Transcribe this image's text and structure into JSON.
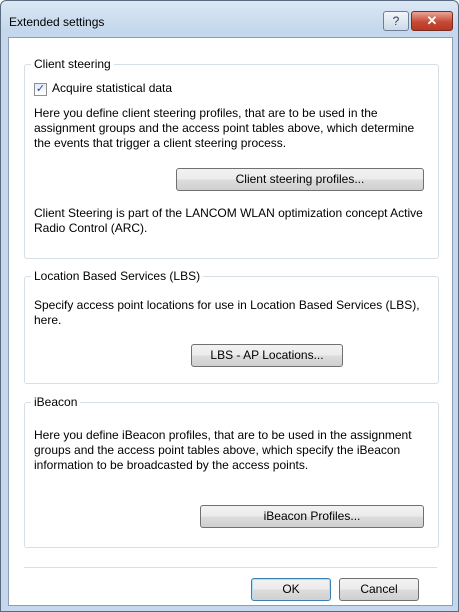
{
  "window": {
    "title": "Extended settings",
    "help_glyph": "?",
    "close_glyph": "✕"
  },
  "client_steering": {
    "title": "Client steering",
    "checkbox_label": "Acquire statistical data",
    "checkbox_checked": true,
    "checkmark_glyph": "✓",
    "description": "Here you define client steering profiles, that are to be used in the assignment groups and the access point tables above, which determine the events that trigger a client steering process.",
    "button_label": "Client steering profiles...",
    "note": "Client Steering is part of the LANCOM WLAN optimization concept Active Radio Control (ARC)."
  },
  "lbs": {
    "title": "Location Based Services (LBS)",
    "description": "Specify access point locations for use in Location Based Services (LBS), here.",
    "button_label": "LBS - AP Locations..."
  },
  "ibeacon": {
    "title": "iBeacon",
    "description": "Here you define iBeacon profiles, that are to be used in the assignment groups and the access point tables above, which specify the iBeacon information to be broadcasted by the access points.",
    "button_label": "iBeacon Profiles..."
  },
  "footer": {
    "ok_label": "OK",
    "cancel_label": "Cancel"
  }
}
